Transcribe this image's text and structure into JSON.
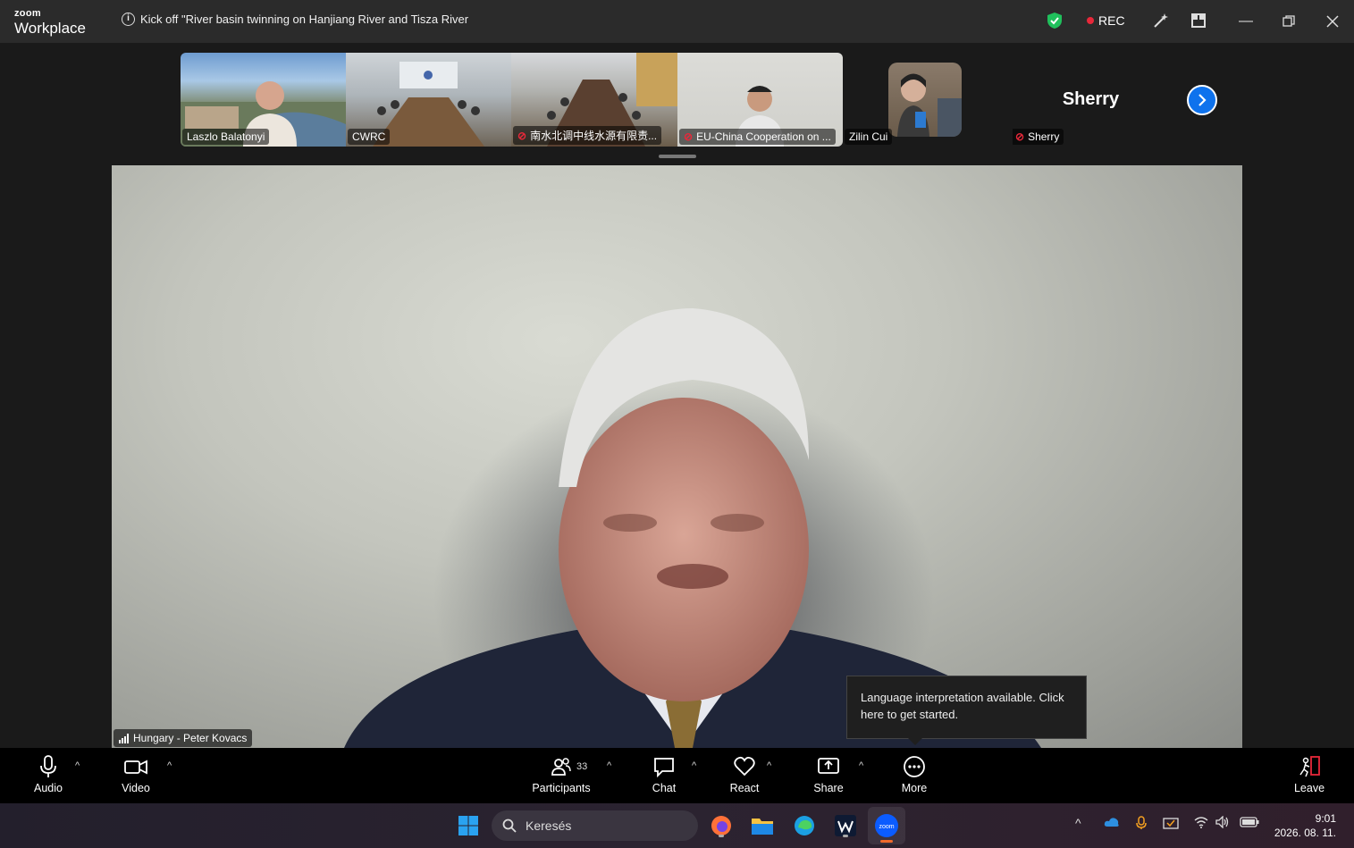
{
  "app": {
    "brand_top": "zoom",
    "brand_bottom": "Workplace"
  },
  "meeting": {
    "title": "Kick off \"River basin twinning on Hanjiang River and Tisza River"
  },
  "recording": {
    "label": "REC"
  },
  "gallery": {
    "tiles": [
      {
        "name": "Laszlo Balatonyi",
        "muted": false
      },
      {
        "name": "CWRC",
        "muted": false
      },
      {
        "name": "南水北调中线水源有限责...",
        "muted": true
      },
      {
        "name": "EU-China Cooperation on ...",
        "muted": true
      },
      {
        "name": "Zilin Cui",
        "muted": false
      }
    ],
    "sherry": {
      "display_name": "Sherry",
      "label": "Sherry",
      "muted": true
    }
  },
  "main": {
    "speaker_label": "Hungary - Peter Kovacs"
  },
  "tooltip": {
    "text": "Language interpretation available. Click here to get started."
  },
  "toolbar": {
    "audio": "Audio",
    "video": "Video",
    "participants": "Participants",
    "participants_count": "33",
    "chat": "Chat",
    "react": "React",
    "share": "Share",
    "more": "More",
    "leave": "Leave"
  },
  "taskbar": {
    "search_placeholder": "Keresés",
    "time": "9:01",
    "date": "2026. 08. 11."
  },
  "colors": {
    "accent": "#0e72ed",
    "rec": "#e8283a",
    "shield": "#20c05c"
  }
}
